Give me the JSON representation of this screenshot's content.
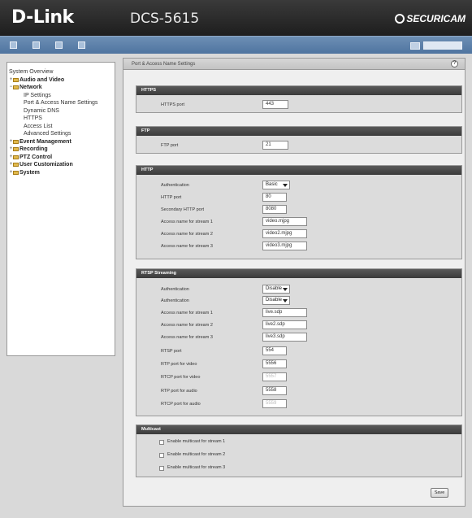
{
  "header": {
    "brand": "D-Link",
    "model": "DCS-5615",
    "brand_right": "SECURICAM"
  },
  "sidebar": {
    "items": [
      {
        "label": "System Overview",
        "level": 0
      },
      {
        "label": "Audio and Video",
        "level": 1,
        "bold": true
      },
      {
        "label": "Network",
        "level": 1,
        "bold": true
      },
      {
        "label": "IP Settings",
        "level": 2
      },
      {
        "label": "Port & Access Name Settings",
        "level": 2
      },
      {
        "label": "Dynamic DNS",
        "level": 2
      },
      {
        "label": "HTTPS",
        "level": 2
      },
      {
        "label": "Access List",
        "level": 2
      },
      {
        "label": "Advanced Settings",
        "level": 2
      },
      {
        "label": "Event Management",
        "level": 1,
        "bold": true
      },
      {
        "label": "Recording",
        "level": 1,
        "bold": true
      },
      {
        "label": "PTZ Control",
        "level": 1,
        "bold": true
      },
      {
        "label": "User Customization",
        "level": 1,
        "bold": true
      },
      {
        "label": "System",
        "level": 1,
        "bold": true
      }
    ]
  },
  "main": {
    "title": "Port & Access Name Settings",
    "help": "?",
    "https": {
      "header": "HTTPS",
      "port_label": "HTTPS port",
      "port_value": "443"
    },
    "ftp": {
      "header": "FTP",
      "port_label": "FTP port",
      "port_value": "21"
    },
    "http": {
      "header": "HTTP",
      "auth_label": "Authentication",
      "auth_value": "Basic",
      "port_label": "HTTP port",
      "port_value": "80",
      "sec_port_label": "Secondary HTTP port",
      "sec_port_value": "8080",
      "s1_label": "Access name for stream 1",
      "s1_value": "video.mjpg",
      "s2_label": "Access name for stream 2",
      "s2_value": "video2.mjpg",
      "s3_label": "Access name for stream 3",
      "s3_value": "video3.mjpg"
    },
    "rtsp": {
      "header": "RTSP Streaming",
      "auth_label": "Authentication",
      "auth_value": "Disable",
      "auth2_label": "Authentication",
      "auth2_value": "Disable",
      "s1_label": "Access name for stream 1",
      "s1_value": "live.sdp",
      "s2_label": "Access name for stream 2",
      "s2_value": "live2.sdp",
      "s3_label": "Access name for stream 3",
      "s3_value": "live3.sdp",
      "rtsp_port_label": "RTSP port",
      "rtsp_port_value": "554",
      "rtp_video_label": "RTP port for video",
      "rtp_video_value": "5556",
      "rtcp_video_label": "RTCP port for video",
      "rtcp_video_value": "5557",
      "rtp_audio_label": "RTP port for audio",
      "rtp_audio_value": "5558",
      "rtcp_audio_label": "RTCP port for audio",
      "rtcp_audio_value": "5559"
    },
    "multicast": {
      "header": "Multicast",
      "m1": "Enable multicast for stream 1",
      "m2": "Enable multicast for stream 2",
      "m3": "Enable multicast for stream 3"
    },
    "save_label": "Save"
  },
  "colors": {
    "toolbar": "#5a7ea8",
    "section_header": "#464646",
    "panel_bg": "#dcdcdc"
  }
}
